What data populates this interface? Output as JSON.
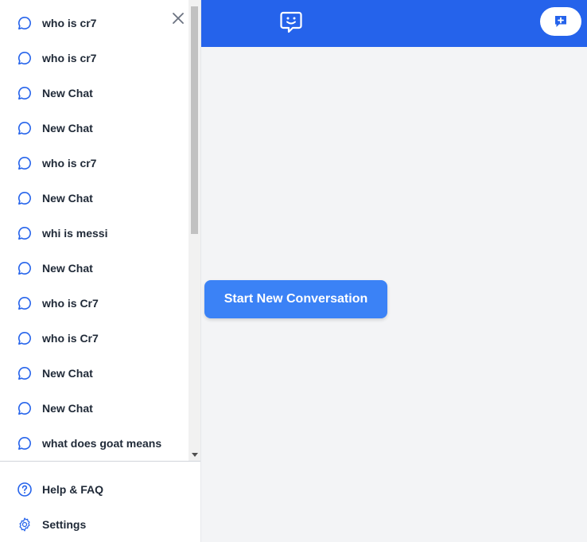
{
  "colors": {
    "accent": "#2563eb",
    "button": "#3b82f6",
    "icon": "#2563eb",
    "text": "#1f2937"
  },
  "sidebar": {
    "chats": [
      {
        "label": "who is cr7",
        "icon": "chat-bubble-icon"
      },
      {
        "label": "who is cr7",
        "icon": "chat-bubble-icon"
      },
      {
        "label": "New Chat",
        "icon": "chat-bubble-icon"
      },
      {
        "label": "New Chat",
        "icon": "chat-bubble-icon"
      },
      {
        "label": "who is cr7",
        "icon": "chat-bubble-icon"
      },
      {
        "label": "New Chat",
        "icon": "chat-bubble-icon"
      },
      {
        "label": "whi is messi",
        "icon": "chat-bubble-icon"
      },
      {
        "label": "New Chat",
        "icon": "chat-bubble-icon"
      },
      {
        "label": "who is Cr7",
        "icon": "chat-bubble-icon"
      },
      {
        "label": "who is Cr7",
        "icon": "chat-bubble-icon"
      },
      {
        "label": "New Chat",
        "icon": "chat-bubble-icon"
      },
      {
        "label": "New Chat",
        "icon": "chat-bubble-icon"
      },
      {
        "label": "what does goat means",
        "icon": "chat-bubble-icon"
      }
    ],
    "close_icon": "close-icon",
    "footer": {
      "help_label": "Help & FAQ",
      "settings_label": "Settings"
    }
  },
  "header": {
    "logo_icon": "smiley-chat-icon",
    "new_chat_icon": "plus-message-icon"
  },
  "main": {
    "start_button_label": "Start New Conversation"
  }
}
